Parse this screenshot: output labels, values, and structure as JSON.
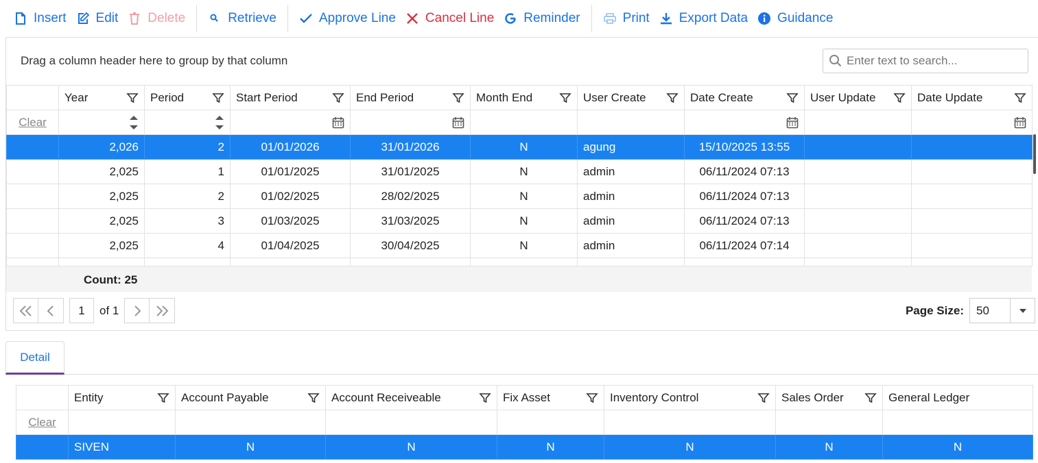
{
  "toolbar": {
    "insert": "Insert",
    "edit": "Edit",
    "delete": "Delete",
    "retrieve": "Retrieve",
    "approve_line": "Approve Line",
    "cancel_line": "Cancel Line",
    "reminder": "Reminder",
    "print": "Print",
    "export_data": "Export Data",
    "guidance": "Guidance"
  },
  "grid": {
    "group_hint": "Drag a column header here to group by that column",
    "search_placeholder": "Enter text to search...",
    "clear": "Clear",
    "columns": [
      "Year",
      "Period",
      "Start Period",
      "End Period",
      "Month End",
      "User Create",
      "Date Create",
      "User Update",
      "Date Update"
    ],
    "rows": [
      {
        "year": "2,026",
        "period": "2",
        "start": "01/01/2026",
        "end": "31/01/2026",
        "month_end": "N",
        "user_create": "agung",
        "date_create": "15/10/2025 13:55",
        "user_update": "",
        "date_update": ""
      },
      {
        "year": "2,025",
        "period": "1",
        "start": "01/01/2025",
        "end": "31/01/2025",
        "month_end": "N",
        "user_create": "admin",
        "date_create": "06/11/2024 07:13",
        "user_update": "",
        "date_update": ""
      },
      {
        "year": "2,025",
        "period": "2",
        "start": "01/02/2025",
        "end": "28/02/2025",
        "month_end": "N",
        "user_create": "admin",
        "date_create": "06/11/2024 07:13",
        "user_update": "",
        "date_update": ""
      },
      {
        "year": "2,025",
        "period": "3",
        "start": "01/03/2025",
        "end": "31/03/2025",
        "month_end": "N",
        "user_create": "admin",
        "date_create": "06/11/2024 07:13",
        "user_update": "",
        "date_update": ""
      },
      {
        "year": "2,025",
        "period": "4",
        "start": "01/04/2025",
        "end": "30/04/2025",
        "month_end": "N",
        "user_create": "admin",
        "date_create": "06/11/2024 07:14",
        "user_update": "",
        "date_update": ""
      }
    ],
    "count_label": "Count: 25"
  },
  "pager": {
    "page": "1",
    "of_label": "of 1",
    "page_size_label": "Page Size:",
    "page_size": "50"
  },
  "tabs": {
    "detail": "Detail"
  },
  "detail": {
    "clear": "Clear",
    "columns": [
      "Entity",
      "Account Payable",
      "Account Receiveable",
      "Fix Asset",
      "Inventory Control",
      "Sales Order",
      "General Ledger"
    ],
    "rows": [
      {
        "entity": "SIVEN",
        "ap": "N",
        "ar": "N",
        "fa": "N",
        "ic": "N",
        "so": "N",
        "gl": "N"
      }
    ]
  },
  "colors": {
    "accent": "#1a73e8",
    "selected_row": "#1a82f0",
    "danger": "#d93040",
    "tab_underline": "#6a3fa0"
  }
}
